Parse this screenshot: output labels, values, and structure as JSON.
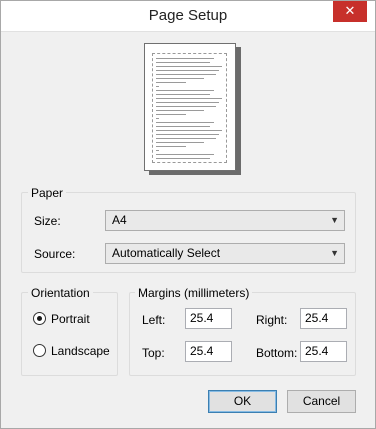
{
  "window": {
    "title": "Page Setup",
    "close_glyph": "✕"
  },
  "paper": {
    "group_label": "Paper",
    "size_label": "Size:",
    "size_value": "A4",
    "source_label": "Source:",
    "source_value": "Automatically Select"
  },
  "orientation": {
    "group_label": "Orientation",
    "portrait_label": "Portrait",
    "landscape_label": "Landscape",
    "selected": "Portrait"
  },
  "margins": {
    "group_label": "Margins (millimeters)",
    "left_label": "Left:",
    "left_value": "25.4",
    "right_label": "Right:",
    "right_value": "25.4",
    "top_label": "Top:",
    "top_value": "25.4",
    "bottom_label": "Bottom:",
    "bottom_value": "25.4"
  },
  "buttons": {
    "ok_label": "OK",
    "cancel_label": "Cancel"
  },
  "colors": {
    "close_button": "#c7302b",
    "default_button_border": "#3c7fb1"
  }
}
